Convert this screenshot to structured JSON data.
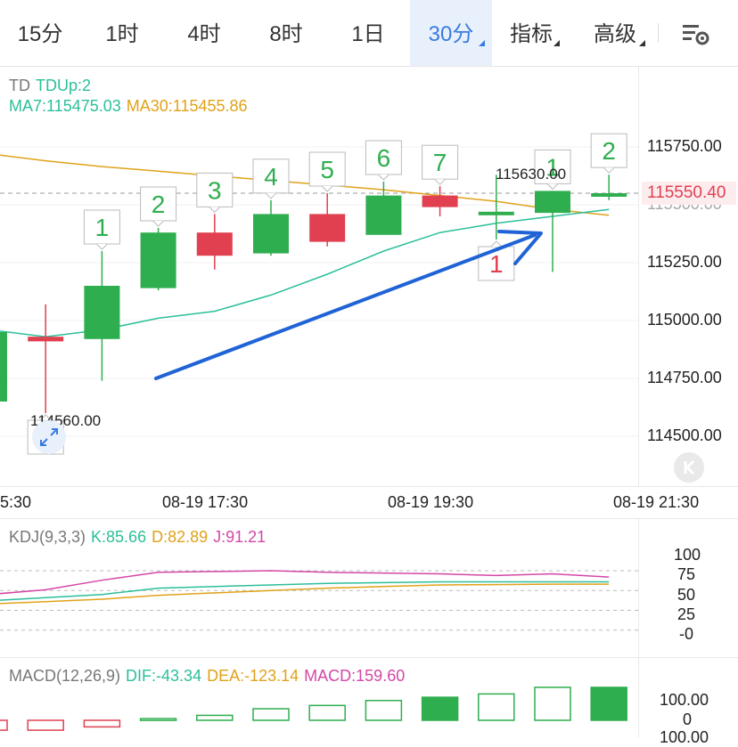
{
  "tabs": [
    {
      "label": "15分",
      "active": false
    },
    {
      "label": "1时",
      "active": false
    },
    {
      "label": "4时",
      "active": false
    },
    {
      "label": "8时",
      "active": false
    },
    {
      "label": "1日",
      "active": false
    },
    {
      "label": "30分",
      "active": true
    },
    {
      "label": "指标",
      "active": false
    },
    {
      "label": "高级",
      "active": false
    }
  ],
  "main": {
    "legend_td": "TD",
    "legend_tdup": "TDUp:2",
    "ma7": "MA7:115475.03",
    "ma30": "MA30:115455.86",
    "y_ticks": [
      "115750.00",
      "115500.00",
      "115250.00",
      "115000.00",
      "114750.00",
      "114500.00"
    ],
    "current_price": "115550.40",
    "high_label": "115630.00",
    "low_label": "114560.00",
    "time_labels": [
      "5:30",
      "08-19 17:30",
      "08-19 19:30",
      "08-19 21:30"
    ]
  },
  "kdj": {
    "title": "KDJ(9,3,3)",
    "k": "K:85.66",
    "d": "D:82.89",
    "j": "J:91.21",
    "ticks": [
      "100",
      "75",
      "50",
      "25",
      "-0"
    ]
  },
  "macd": {
    "title": "MACD(12,26,9)",
    "dif": "DIF:-43.34",
    "dea": "DEA:-123.14",
    "macd": "MACD:159.60",
    "ticks": [
      "100.00",
      "0",
      "100.00"
    ]
  },
  "colors": {
    "up": "#2fae4f",
    "down": "#e04050",
    "ma7": "#2bbf9a",
    "ma30": "#e0a21a",
    "j": "#d447a6",
    "accent": "#3a7be0",
    "arrow": "#1f63d6"
  },
  "chart_data": {
    "type": "candlestick",
    "candles": [
      {
        "o": 114650,
        "h": 115100,
        "l": 114520,
        "c": 114950
      },
      {
        "o": 114930,
        "h": 115070,
        "l": 114600,
        "c": 114910
      },
      {
        "o": 114920,
        "h": 115300,
        "l": 114740,
        "c": 115150
      },
      {
        "o": 115140,
        "h": 115400,
        "l": 115130,
        "c": 115380
      },
      {
        "o": 115380,
        "h": 115460,
        "l": 115220,
        "c": 115280
      },
      {
        "o": 115290,
        "h": 115520,
        "l": 115280,
        "c": 115460
      },
      {
        "o": 115460,
        "h": 115550,
        "l": 115320,
        "c": 115340
      },
      {
        "o": 115370,
        "h": 115600,
        "l": 115370,
        "c": 115540
      },
      {
        "o": 115540,
        "h": 115580,
        "l": 115450,
        "c": 115490
      },
      {
        "o": 115470,
        "h": 115630,
        "l": 115350,
        "c": 115470
      },
      {
        "o": 115465,
        "h": 115560,
        "l": 115210,
        "c": 115560
      },
      {
        "o": 115550,
        "h": 115630,
        "l": 115520,
        "c": 115550
      }
    ],
    "td_labels": [
      {
        "i": 1,
        "text": "1",
        "pos": "below",
        "color": "down"
      },
      {
        "i": 2,
        "text": "1",
        "pos": "above",
        "color": "up"
      },
      {
        "i": 3,
        "text": "2",
        "pos": "above",
        "color": "up"
      },
      {
        "i": 4,
        "text": "3",
        "pos": "above",
        "color": "up"
      },
      {
        "i": 5,
        "text": "4",
        "pos": "above",
        "color": "up"
      },
      {
        "i": 6,
        "text": "5",
        "pos": "above",
        "color": "up"
      },
      {
        "i": 7,
        "text": "6",
        "pos": "above",
        "color": "up"
      },
      {
        "i": 8,
        "text": "7",
        "pos": "above",
        "color": "up"
      },
      {
        "i": 9,
        "text": "1",
        "pos": "below",
        "color": "down"
      },
      {
        "i": 10,
        "text": "1",
        "pos": "above",
        "color": "up"
      },
      {
        "i": 11,
        "text": "2",
        "pos": "above",
        "color": "up"
      }
    ],
    "ma7": [
      114960,
      114930,
      114960,
      115010,
      115040,
      115110,
      115200,
      115300,
      115380,
      115420,
      115450,
      115480
    ],
    "ma30": [
      115720,
      115690,
      115665,
      115645,
      115625,
      115605,
      115585,
      115565,
      115540,
      115515,
      115480,
      115455
    ],
    "kdj": {
      "k": [
        62,
        66,
        70,
        78,
        80,
        82,
        84,
        85,
        86,
        86,
        86,
        86
      ],
      "d": [
        58,
        61,
        64,
        69,
        72,
        75,
        78,
        80,
        82,
        82.5,
        83,
        83
      ],
      "j": [
        70,
        76,
        88,
        98,
        99,
        100,
        98,
        97,
        96,
        94,
        96,
        92
      ]
    },
    "macd_hist": [
      -30,
      -30,
      -20,
      5,
      15,
      35,
      45,
      60,
      70,
      80,
      100,
      100
    ]
  }
}
